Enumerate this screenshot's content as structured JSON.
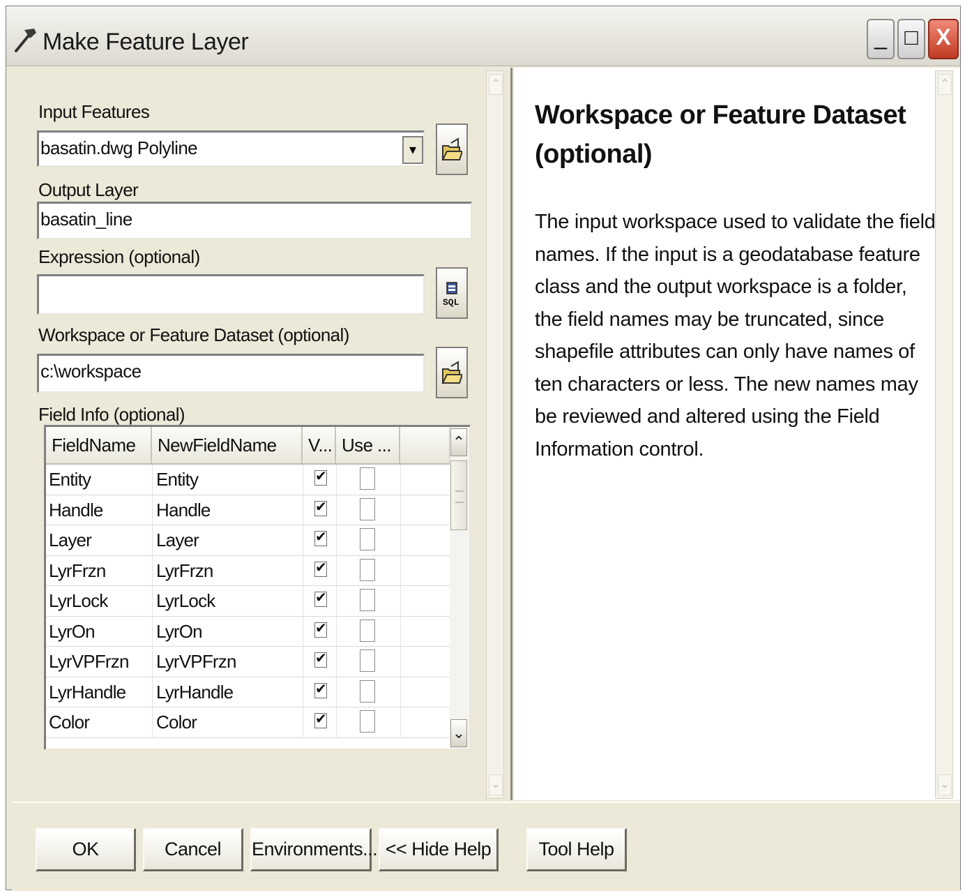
{
  "window": {
    "title": "Make Feature Layer",
    "controls": {
      "minimize": "_",
      "maximize": "□",
      "close": "X"
    }
  },
  "form": {
    "input_features": {
      "label": "Input Features",
      "value": "basatin.dwg Polyline",
      "dropdown_glyph": "▾"
    },
    "output_layer": {
      "label": "Output Layer",
      "value": "basatin_line"
    },
    "expression": {
      "label": "Expression (optional)",
      "value": ""
    },
    "workspace": {
      "label": "Workspace or Feature Dataset (optional)",
      "value": "c:\\workspace"
    },
    "field_info": {
      "label": "Field Info (optional)",
      "columns": [
        "FieldName",
        "NewFieldName",
        "V...",
        "Use ..."
      ],
      "rows": [
        {
          "field": "Entity",
          "new": "Entity",
          "visible": true,
          "use": false
        },
        {
          "field": "Handle",
          "new": "Handle",
          "visible": true,
          "use": false
        },
        {
          "field": "Layer",
          "new": "Layer",
          "visible": true,
          "use": false
        },
        {
          "field": "LyrFrzn",
          "new": "LyrFrzn",
          "visible": true,
          "use": false
        },
        {
          "field": "LyrLock",
          "new": "LyrLock",
          "visible": true,
          "use": false
        },
        {
          "field": "LyrOn",
          "new": "LyrOn",
          "visible": true,
          "use": false
        },
        {
          "field": "LyrVPFrzn",
          "new": "LyrVPFrzn",
          "visible": true,
          "use": false
        },
        {
          "field": "LyrHandle",
          "new": "LyrHandle",
          "visible": true,
          "use": false
        },
        {
          "field": "Color",
          "new": "Color",
          "visible": true,
          "use": false
        }
      ]
    }
  },
  "help": {
    "title": "Workspace or Feature Dataset (optional)",
    "body": "The input workspace used to validate the field names. If the input is a geodatabase feature class and the output workspace is a folder, the field names may be truncated, since shapefile attributes can only have names of ten characters or less. The new names may be reviewed and altered using the Field Information control."
  },
  "buttons": {
    "ok": "OK",
    "cancel": "Cancel",
    "environments": "Environments...",
    "hide_help": "<< Hide Help",
    "tool_help": "Tool Help"
  },
  "icons": {
    "title": "hammer-icon",
    "browse": "open-folder-icon",
    "sql": "sql-icon"
  }
}
